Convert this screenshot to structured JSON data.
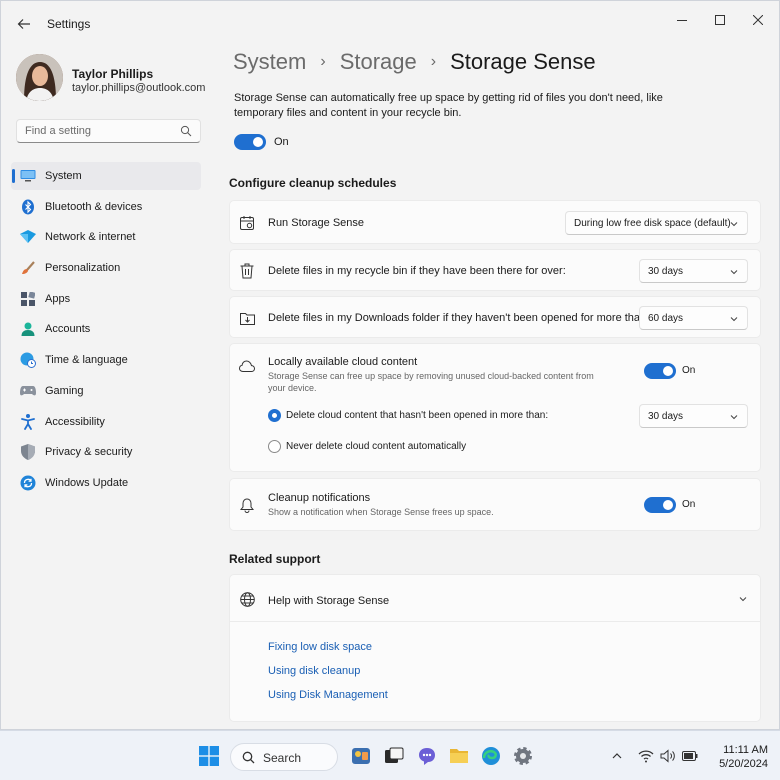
{
  "window": {
    "title": "Settings"
  },
  "profile": {
    "name": "Taylor Phillips",
    "email": "taylor.phillips@outlook.com"
  },
  "search": {
    "placeholder": "Find a setting"
  },
  "sidebar": {
    "items": [
      {
        "label": "System",
        "icon": "monitor-icon",
        "active": true
      },
      {
        "label": "Bluetooth & devices",
        "icon": "bluetooth-icon"
      },
      {
        "label": "Network & internet",
        "icon": "wifi-diamond-icon"
      },
      {
        "label": "Personalization",
        "icon": "brush-icon"
      },
      {
        "label": "Apps",
        "icon": "apps-icon"
      },
      {
        "label": "Accounts",
        "icon": "person-icon"
      },
      {
        "label": "Time & language",
        "icon": "globe-clock-icon"
      },
      {
        "label": "Gaming",
        "icon": "gamepad-icon"
      },
      {
        "label": "Accessibility",
        "icon": "accessibility-icon"
      },
      {
        "label": "Privacy & security",
        "icon": "shield-icon"
      },
      {
        "label": "Windows Update",
        "icon": "update-icon"
      }
    ]
  },
  "breadcrumb": {
    "root": "System",
    "middle": "Storage",
    "current": "Storage Sense",
    "separator": "›"
  },
  "intro": {
    "description": "Storage Sense can automatically free up space by getting rid of files you don't need, like temporary files and content in your recycle bin.",
    "toggle_label": "On",
    "toggle_on": true
  },
  "schedules": {
    "heading": "Configure cleanup schedules",
    "run": {
      "label": "Run Storage Sense",
      "value": "During low free disk space (default)"
    },
    "recycle": {
      "label": "Delete files in my recycle bin if they have been there for over:",
      "value": "30 days"
    },
    "downloads": {
      "label": "Delete files in my Downloads folder if they haven't been opened for more than:",
      "value": "60 days"
    },
    "cloud": {
      "label": "Locally available cloud content",
      "sub": "Storage Sense can free up space by removing unused cloud-backed content from your device.",
      "toggle_label": "On",
      "toggle_on": true,
      "option_delete": "Delete cloud content that hasn't been opened in more than:",
      "option_delete_value": "30 days",
      "option_never": "Never delete cloud content automatically",
      "selected": "delete"
    },
    "notifications": {
      "label": "Cleanup notifications",
      "sub": "Show a notification when Storage Sense frees up space.",
      "toggle_label": "On",
      "toggle_on": true
    }
  },
  "support": {
    "heading": "Related support",
    "help_label": "Help with Storage Sense",
    "links": [
      "Fixing low disk space",
      "Using disk cleanup",
      "Using Disk Management"
    ]
  },
  "taskbar": {
    "search_label": "Search",
    "time": "11:11 AM",
    "date": "5/20/2024"
  },
  "colors": {
    "accent": "#1f6fd0",
    "link": "#1a5fb4"
  }
}
